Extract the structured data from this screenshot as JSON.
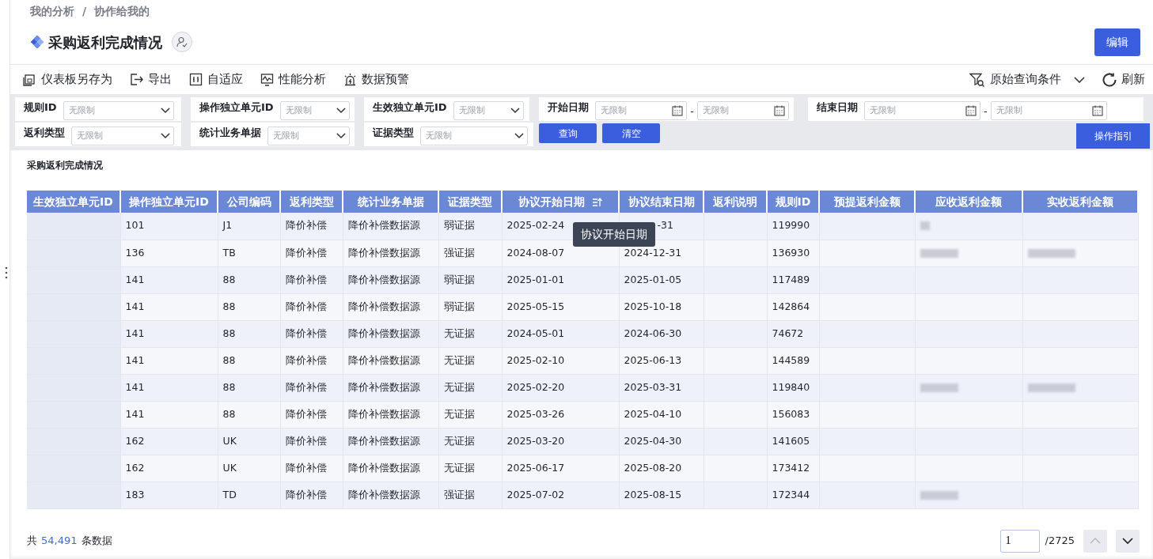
{
  "breadcrumb": [
    "我的分析",
    "协作给我的"
  ],
  "breadcrumb_separator": "/",
  "title": "采购返利完成情况",
  "edit_button": "编辑",
  "toolbar": {
    "left": [
      "仪表板另存为",
      "导出",
      "自适应",
      "性能分析",
      "数据预警"
    ],
    "query_conditions": "原始查询条件",
    "refresh": "刷新"
  },
  "filters": [
    {
      "kind": "select",
      "label": "规则ID",
      "placeholder": "无限制"
    },
    {
      "kind": "select",
      "label": "操作独立单元ID",
      "placeholder": "无限制"
    },
    {
      "kind": "select",
      "label": "生效独立单元ID",
      "placeholder": "无限制"
    },
    {
      "kind": "daterange",
      "label": "开始日期",
      "placeholder_from": "无限制",
      "separator": "-",
      "placeholder_to": "无限制"
    },
    {
      "kind": "daterange",
      "label": "结束日期",
      "placeholder_from": "无限制",
      "separator": "-",
      "placeholder_to": "无限制"
    },
    {
      "kind": "select",
      "label": "返利类型",
      "placeholder": "无限制"
    },
    {
      "kind": "select",
      "label": "统计业务单据",
      "placeholder": "无限制"
    },
    {
      "kind": "select",
      "label": "证据类型",
      "placeholder": "无限制"
    }
  ],
  "query_button": "查询",
  "clear_button": "清空",
  "guide_button": "操作指引",
  "table": {
    "title": "采购返利完成情况",
    "columns": [
      {
        "label": "生效独立单元ID",
        "sorted": false
      },
      {
        "label": "操作独立单元ID",
        "sorted": false
      },
      {
        "label": "公司编码",
        "sorted": false
      },
      {
        "label": "返利类型",
        "sorted": false
      },
      {
        "label": "统计业务单据",
        "sorted": false
      },
      {
        "label": "证据类型",
        "sorted": false
      },
      {
        "label": "协议开始日期",
        "sorted": true
      },
      {
        "label": "协议结束日期",
        "sorted": false
      },
      {
        "label": "返利说明",
        "sorted": false
      },
      {
        "label": "规则ID",
        "sorted": false
      },
      {
        "label": "预提返利金额",
        "sorted": false
      },
      {
        "label": "应收返利金额",
        "sorted": false
      },
      {
        "label": "实收返利金额",
        "sorted": false
      }
    ],
    "tooltip": "协议开始日期",
    "rows": [
      {
        "op_unit": "101",
        "company": "J1",
        "rebate_type": "降价补偿",
        "stat_doc": "降价补偿数据源",
        "evidence": "弱证据",
        "start": "2025-02-24",
        "end": "-31",
        "rule_id": "119990",
        "receivable_blurred": true,
        "received_blurred": false
      },
      {
        "op_unit": "136",
        "company": "TB",
        "rebate_type": "降价补偿",
        "stat_doc": "降价补偿数据源",
        "evidence": "强证据",
        "start": "2024-08-07",
        "end": "2024-12-31",
        "rule_id": "136930",
        "receivable_blurred": true,
        "received_blurred": true
      },
      {
        "op_unit": "141",
        "company": "88",
        "rebate_type": "降价补偿",
        "stat_doc": "降价补偿数据源",
        "evidence": "弱证据",
        "start": "2025-01-01",
        "end": "2025-01-05",
        "rule_id": "117489",
        "receivable_blurred": false,
        "received_blurred": false
      },
      {
        "op_unit": "141",
        "company": "88",
        "rebate_type": "降价补偿",
        "stat_doc": "降价补偿数据源",
        "evidence": "弱证据",
        "start": "2025-05-15",
        "end": "2025-10-18",
        "rule_id": "142864",
        "receivable_blurred": false,
        "received_blurred": false
      },
      {
        "op_unit": "141",
        "company": "88",
        "rebate_type": "降价补偿",
        "stat_doc": "降价补偿数据源",
        "evidence": "无证据",
        "start": "2024-05-01",
        "end": "2024-06-30",
        "rule_id": "74672",
        "receivable_blurred": false,
        "received_blurred": false
      },
      {
        "op_unit": "141",
        "company": "88",
        "rebate_type": "降价补偿",
        "stat_doc": "降价补偿数据源",
        "evidence": "无证据",
        "start": "2025-02-10",
        "end": "2025-06-13",
        "rule_id": "144589",
        "receivable_blurred": false,
        "received_blurred": false
      },
      {
        "op_unit": "141",
        "company": "88",
        "rebate_type": "降价补偿",
        "stat_doc": "降价补偿数据源",
        "evidence": "无证据",
        "start": "2025-02-20",
        "end": "2025-03-31",
        "rule_id": "119840",
        "receivable_blurred": true,
        "received_blurred": true
      },
      {
        "op_unit": "141",
        "company": "88",
        "rebate_type": "降价补偿",
        "stat_doc": "降价补偿数据源",
        "evidence": "无证据",
        "start": "2025-03-26",
        "end": "2025-04-10",
        "rule_id": "156083",
        "receivable_blurred": false,
        "received_blurred": false
      },
      {
        "op_unit": "162",
        "company": "UK",
        "rebate_type": "降价补偿",
        "stat_doc": "降价补偿数据源",
        "evidence": "无证据",
        "start": "2025-03-20",
        "end": "2025-04-30",
        "rule_id": "141605",
        "receivable_blurred": false,
        "received_blurred": false
      },
      {
        "op_unit": "162",
        "company": "UK",
        "rebate_type": "降价补偿",
        "stat_doc": "降价补偿数据源",
        "evidence": "无证据",
        "start": "2025-06-17",
        "end": "2025-08-20",
        "rule_id": "173412",
        "receivable_blurred": false,
        "received_blurred": false
      },
      {
        "op_unit": "183",
        "company": "TD",
        "rebate_type": "降价补偿",
        "stat_doc": "降价补偿数据源",
        "evidence": "强证据",
        "start": "2025-07-02",
        "end": "2025-08-15",
        "rule_id": "172344",
        "receivable_blurred": true,
        "received_blurred": false
      }
    ]
  },
  "footer": {
    "prefix": "共",
    "count": "54,491",
    "suffix": "条数据",
    "page": "1",
    "total_pages": "/2725"
  }
}
